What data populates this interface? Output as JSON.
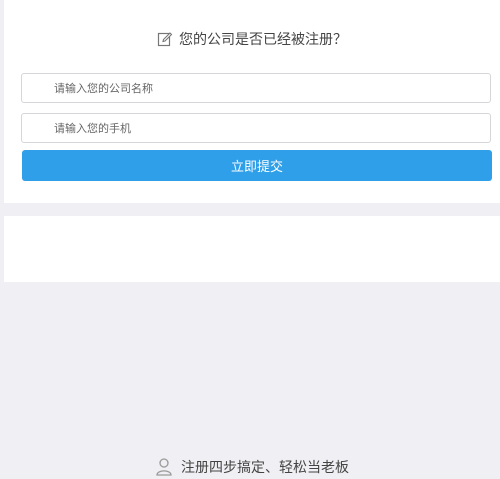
{
  "form": {
    "title": "您的公司是否已经被注册？",
    "title_icon": "edit-icon",
    "company_placeholder": "请输入您的公司名称",
    "phone_placeholder": "请输入您的手机",
    "submit_label": "立即提交",
    "accent_color": "#2f9fe9"
  },
  "promo": {
    "text": "注册四步搞定、轻松当老板",
    "icon": "user-icon"
  }
}
